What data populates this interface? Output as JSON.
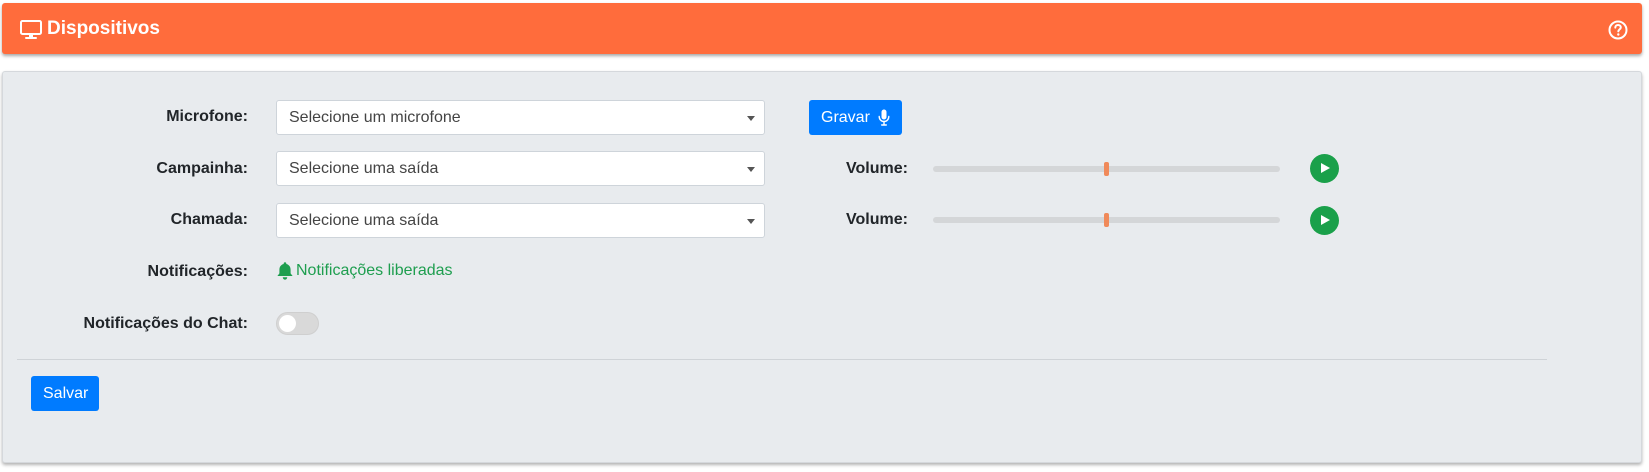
{
  "header": {
    "title": "Dispositivos",
    "icon": "monitor-icon",
    "help_icon": "question-circle-icon",
    "color": "#ff6c3c"
  },
  "form": {
    "microfone": {
      "label": "Microfone:",
      "placeholder": "Selecione um microfone",
      "record_label": "Gravar",
      "record_icon": "microphone-icon"
    },
    "campainha": {
      "label": "Campainha:",
      "placeholder": "Selecione uma saída",
      "volume_label": "Volume:",
      "volume_level": 0.5
    },
    "chamada": {
      "label": "Chamada:",
      "placeholder": "Selecione uma saída",
      "volume_label": "Volume:",
      "volume_level": 0.5
    },
    "notificacoes": {
      "label": "Notificações:",
      "status": "Notificações liberadas",
      "status_icon": "bell-icon",
      "status_color": "#1e9e4f"
    },
    "chat": {
      "label": "Notificações do Chat:",
      "enabled": false
    }
  },
  "actions": {
    "save_label": "Salvar",
    "primary_color": "#007bff"
  }
}
